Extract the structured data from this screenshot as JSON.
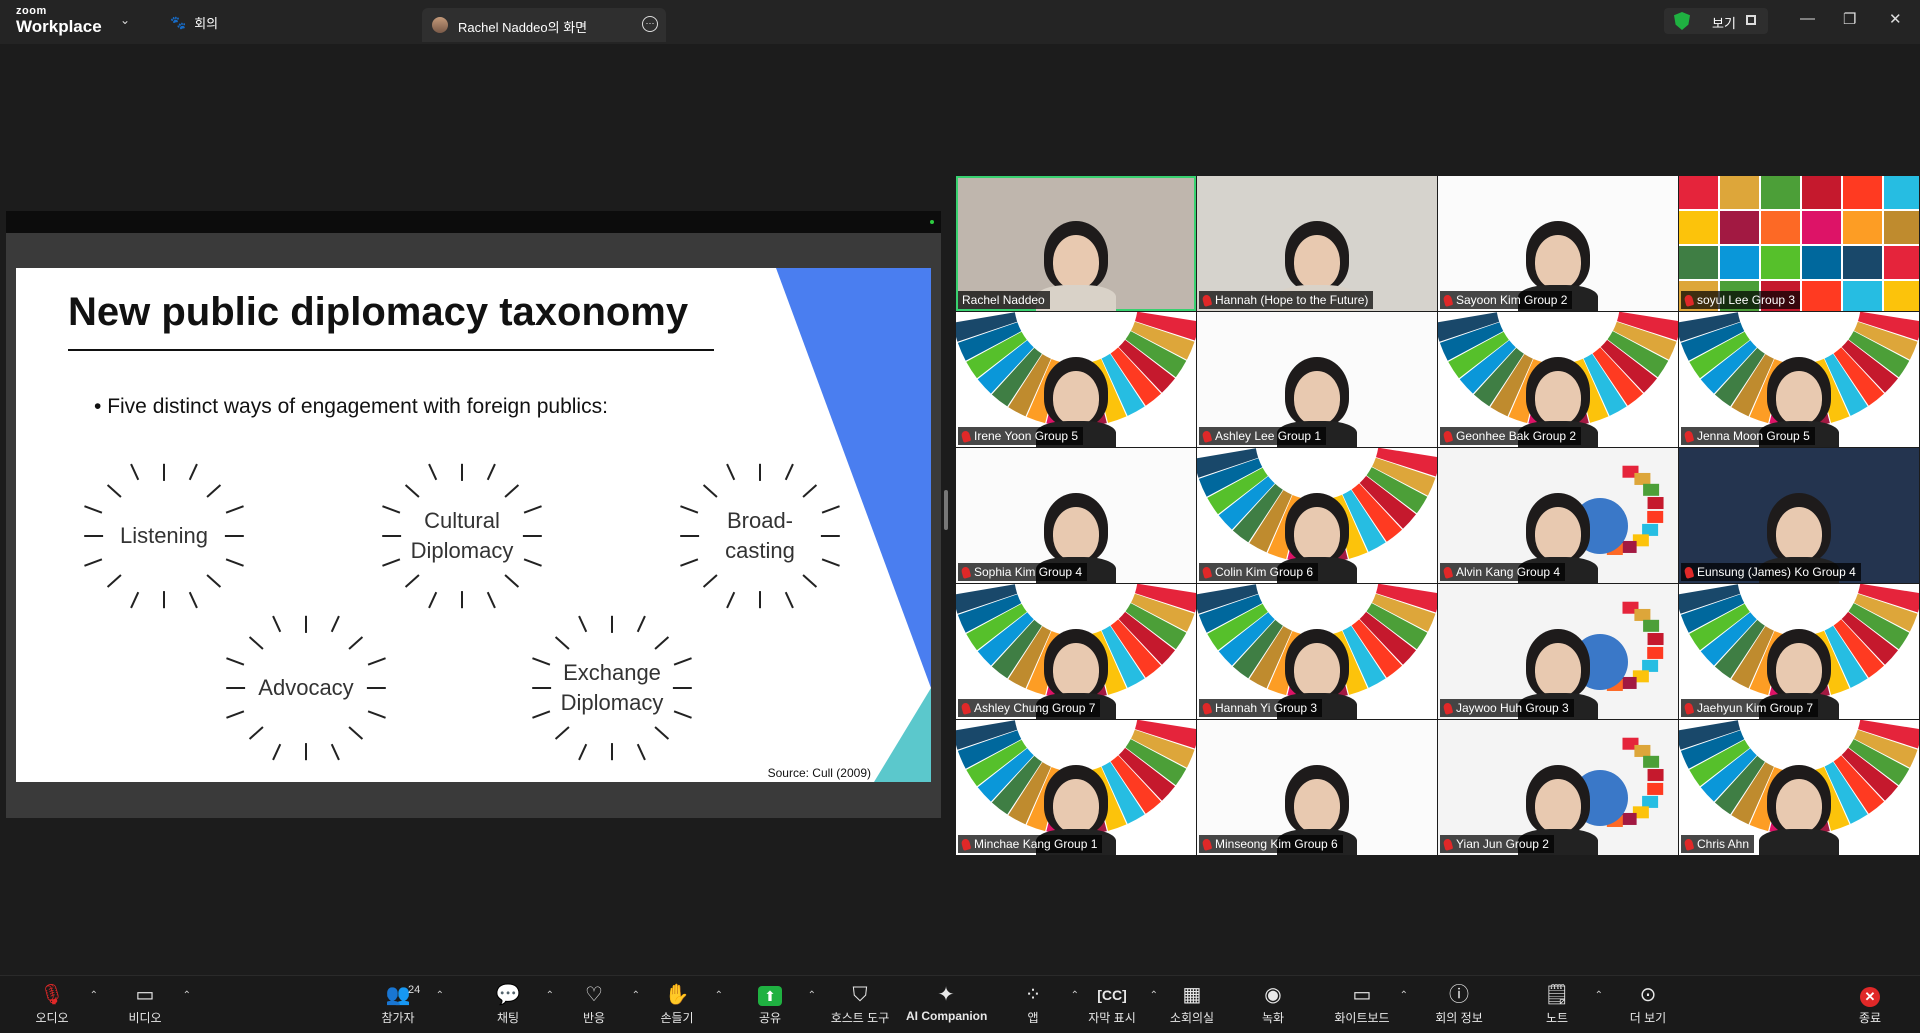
{
  "app": {
    "logo_top": "zoom",
    "logo_bottom": "Workplace",
    "meeting_tab": "회의",
    "share_tab_title": "Rachel Naddeo의 화면",
    "view_label": "보기"
  },
  "slide": {
    "title": "New public diplomacy taxonomy",
    "bullet": "Five distinct ways of engagement with foreign publics:",
    "items": [
      {
        "line1": "Listening",
        "line2": ""
      },
      {
        "line1": "Cultural",
        "line2": "Diplomacy"
      },
      {
        "line1": "Broad-",
        "line2": "casting"
      },
      {
        "line1": "Advocacy",
        "line2": ""
      },
      {
        "line1": "Exchange",
        "line2": "Diplomacy"
      }
    ],
    "source": "Source: Cull (2009)",
    "accent_blue": "#4a7ef0",
    "accent_teal": "#5bc8cc"
  },
  "participants": [
    {
      "name": "Rachel Naddeo",
      "bg": "photo",
      "muted": false,
      "active": true
    },
    {
      "name": "Hannah (Hope to the Future)",
      "bg": "photo",
      "muted": true
    },
    {
      "name": "Sayoon Kim Group 2",
      "bg": "white",
      "muted": true
    },
    {
      "name": "soyul Lee Group 3",
      "bg": "sdg-grid",
      "muted": true
    },
    {
      "name": "Irene Yoon Group 5",
      "bg": "sdg-wheel",
      "muted": true
    },
    {
      "name": "Ashley Lee Group 1",
      "bg": "white",
      "muted": true
    },
    {
      "name": "Geonhee Bak Group 2",
      "bg": "sdg-wheel",
      "muted": true
    },
    {
      "name": "Jenna Moon Group 5",
      "bg": "sdg-wheel",
      "muted": true
    },
    {
      "name": "Sophia Kim Group 4",
      "bg": "white",
      "muted": true
    },
    {
      "name": "Colin Kim Group 6",
      "bg": "sdg-wheel",
      "muted": true
    },
    {
      "name": "Alvin Kang Group 4",
      "bg": "globe",
      "muted": true
    },
    {
      "name": "Eunsung (James) Ko Group 4",
      "bg": "dark-blue",
      "muted": true
    },
    {
      "name": "Ashley Chung Group 7",
      "bg": "sdg-wheel",
      "muted": true
    },
    {
      "name": "Hannah Yi Group 3",
      "bg": "sdg-wheel",
      "muted": true
    },
    {
      "name": "Jaywoo Huh Group 3",
      "bg": "globe",
      "muted": true
    },
    {
      "name": "Jaehyun Kim Group 7",
      "bg": "sdg-wheel",
      "muted": true
    },
    {
      "name": "Minchae Kang Group 1",
      "bg": "sdg-wheel",
      "muted": true
    },
    {
      "name": "Minseong Kim Group 6",
      "bg": "white",
      "muted": true
    },
    {
      "name": "Yian Jun Group 2",
      "bg": "globe",
      "muted": true
    },
    {
      "name": "Chris Ahn",
      "bg": "sdg-wheel",
      "muted": true
    }
  ],
  "toolbar": {
    "audio": "오디오",
    "video": "비디오",
    "participants": "참가자",
    "participants_count": "24",
    "chat": "채팅",
    "react": "반응",
    "raise_hand": "손들기",
    "share": "공유",
    "host_tools": "호스트 도구",
    "ai_companion": "AI Companion",
    "apps": "앱",
    "captions": "자막 표시",
    "breakout": "소회의실",
    "record": "녹화",
    "whiteboard": "화이트보드",
    "meeting_info": "회의 정보",
    "notes": "노트",
    "more": "더 보기",
    "end": "종료"
  },
  "colors": {
    "brand_green": "#1fb141",
    "end_red": "#e02828",
    "active_speaker": "#38d170"
  },
  "sdg_colors": [
    "#e5243b",
    "#dda63a",
    "#4c9f38",
    "#c5192d",
    "#ff3a21",
    "#26bde2",
    "#fcc30b",
    "#a21942",
    "#fd6925",
    "#dd1367",
    "#fd9d24",
    "#bf8b2e",
    "#3f7e44",
    "#0a97d9",
    "#56c02b",
    "#00689d",
    "#19486a"
  ]
}
